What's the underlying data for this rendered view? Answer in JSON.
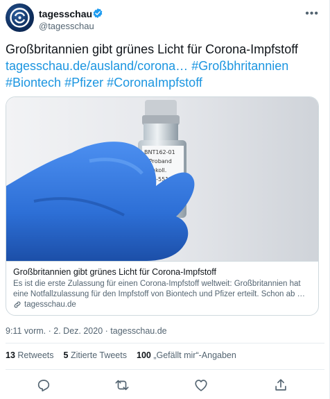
{
  "account": {
    "name": "tagesschau",
    "handle": "@tagesschau"
  },
  "tweet": {
    "headline": "Großbritannien gibt grünes Licht für Corona-Impfstoff",
    "link_text": "tagesschau.de/ausland/corona…",
    "hashtags": [
      "#Großbhritannien",
      "#Biontech",
      "#Pfizer",
      "#CoronaImpfstoff"
    ]
  },
  "card": {
    "title": "Großbritannien gibt grünes Licht für Corona-Impfstoff",
    "description": "Es ist die erste Zulassung für einen Corona-Impfstoff weltweit: Großbritannien hat eine Notfallzulassung für den Impfstoff von Biontech und Pfizer erteilt. Schon ab …",
    "domain": "tagesschau.de",
    "image_label": {
      "line1": "BNT162-01",
      "line2": "Proband",
      "line3": "nkoll.",
      "line4": "D-5513"
    }
  },
  "meta": {
    "time": "9:11 vorm.",
    "date": "2. Dez. 2020",
    "source": "tagesschau.de",
    "separator": "·"
  },
  "stats": {
    "retweets_count": "13",
    "retweets_label": "Retweets",
    "quotes_count": "5",
    "quotes_label": "Zitierte Tweets",
    "likes_count": "100",
    "likes_label": "„Gefällt mir“-Angaben"
  },
  "icons": {
    "more": "more-icon",
    "reply": "reply-icon",
    "retweet": "retweet-icon",
    "like": "like-icon",
    "share": "share-icon",
    "verified": "verified-badge-icon",
    "link": "link-icon"
  },
  "colors": {
    "link": "#1b95e0",
    "muted": "#536471",
    "text": "#0f1419",
    "border": "#cfd9de",
    "glove": "#2d6fd6"
  }
}
